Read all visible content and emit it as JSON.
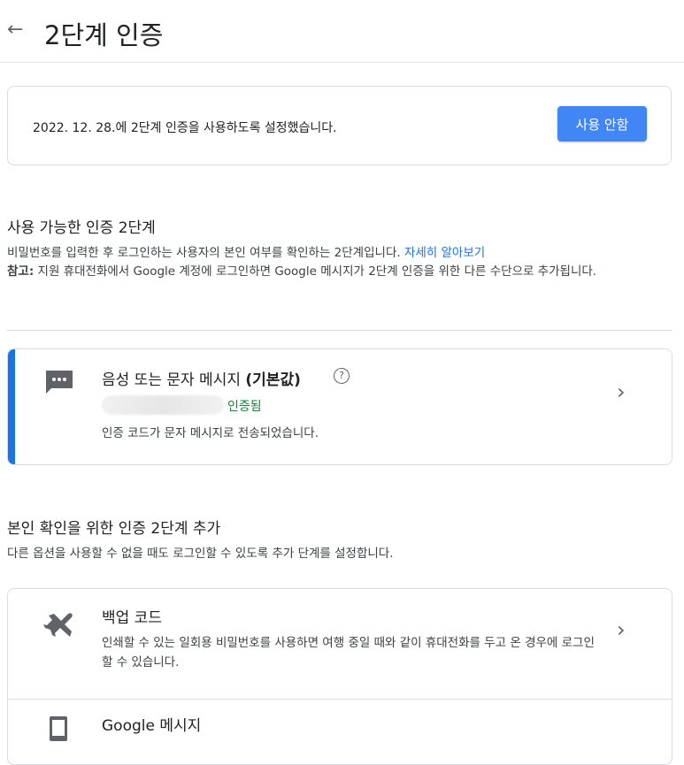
{
  "header": {
    "title": "2단계 인증",
    "back_icon": "arrow-left-icon"
  },
  "status": {
    "text": "2022. 12. 28.에 2단계 인증을 사용하도록 설정했습니다.",
    "disable_label": "사용 안함",
    "button_color": "#4285f4"
  },
  "available": {
    "title": "사용 가능한 인증 2단계",
    "desc": "비밀번호를 입력한 후 로그인하는 사용자의 본인 여부를 확인하는 2단계입니다.",
    "learn_more": "자세히 알아보기",
    "note_label": "참고:",
    "note_text": "지원 휴대전화에서 Google 계정에 로그인하면 Google 메시지가 2단계 인증을 위한 다른 수단으로 추가됩니다."
  },
  "method": {
    "title": "음성 또는 문자 메시지",
    "default_label": "(기본값)",
    "help_icon": "help-circle-icon",
    "status": "인증됨",
    "desc": "인증 코드가 문자 메시지로 전송되었습니다.",
    "accent_color": "#1a73e8",
    "icon": "sms-icon"
  },
  "add": {
    "title": "본인 확인을 위한 인증 2단계 추가",
    "desc": "다른 옵션을 사용할 수 없을 때도 로그인할 수 있도록 추가 단계를 설정합니다.",
    "options": [
      {
        "title": "백업 코드",
        "desc": "인쇄할 수 있는 일회용 비밀번호를 사용하면 여행 중일 때와 같이 휴대전화를 두고 온 경우에 로그인할 수 있습니다.",
        "icon": "airplane-icon"
      },
      {
        "title": "Google 메시지",
        "icon": "phone-icon"
      }
    ]
  }
}
